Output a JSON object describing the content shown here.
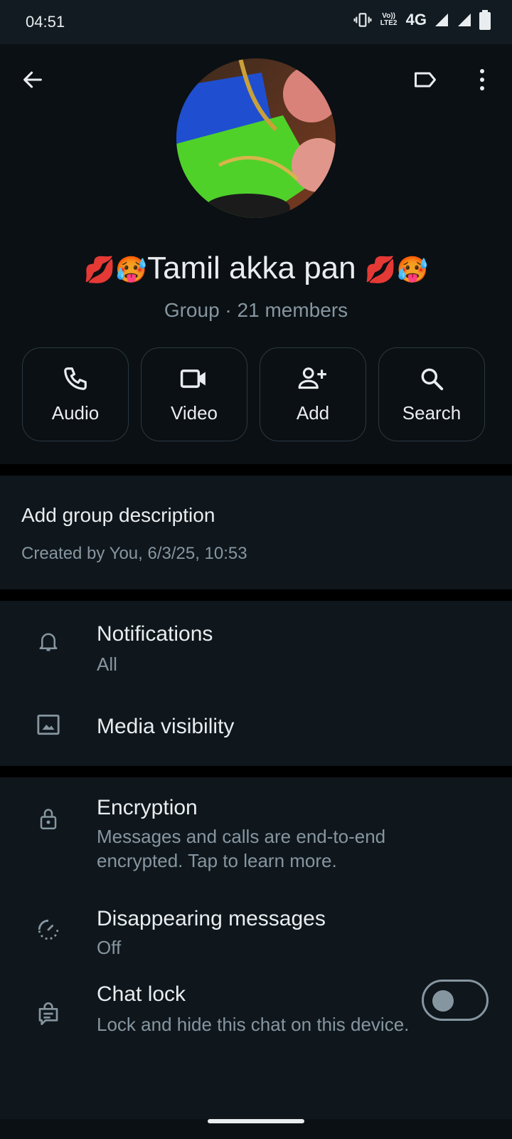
{
  "status_bar": {
    "time": "04:51",
    "volte": "Vo)) LTE2",
    "network": "4G"
  },
  "group": {
    "name": "Tamil akka pan ",
    "emoji_left": "💋🥵",
    "emoji_right": "💋🥵",
    "subtitle": "Group · 21 members"
  },
  "actions": [
    {
      "label": "Audio",
      "icon": "phone-icon"
    },
    {
      "label": "Video",
      "icon": "video-icon"
    },
    {
      "label": "Add",
      "icon": "add-person-icon"
    },
    {
      "label": "Search",
      "icon": "search-icon"
    }
  ],
  "description": {
    "title": "Add group description",
    "created": "Created by You, 6/3/25, 10:53"
  },
  "settings": {
    "notifications": {
      "title": "Notifications",
      "value": "All"
    },
    "media_visibility": {
      "title": "Media visibility"
    },
    "encryption": {
      "title": "Encryption",
      "subtitle": "Messages and calls are end-to-end encrypted. Tap to learn more."
    },
    "disappearing": {
      "title": "Disappearing messages",
      "value": "Off"
    },
    "chat_lock": {
      "title": "Chat lock",
      "subtitle": "Lock and hide this chat on this device.",
      "enabled": false
    }
  }
}
